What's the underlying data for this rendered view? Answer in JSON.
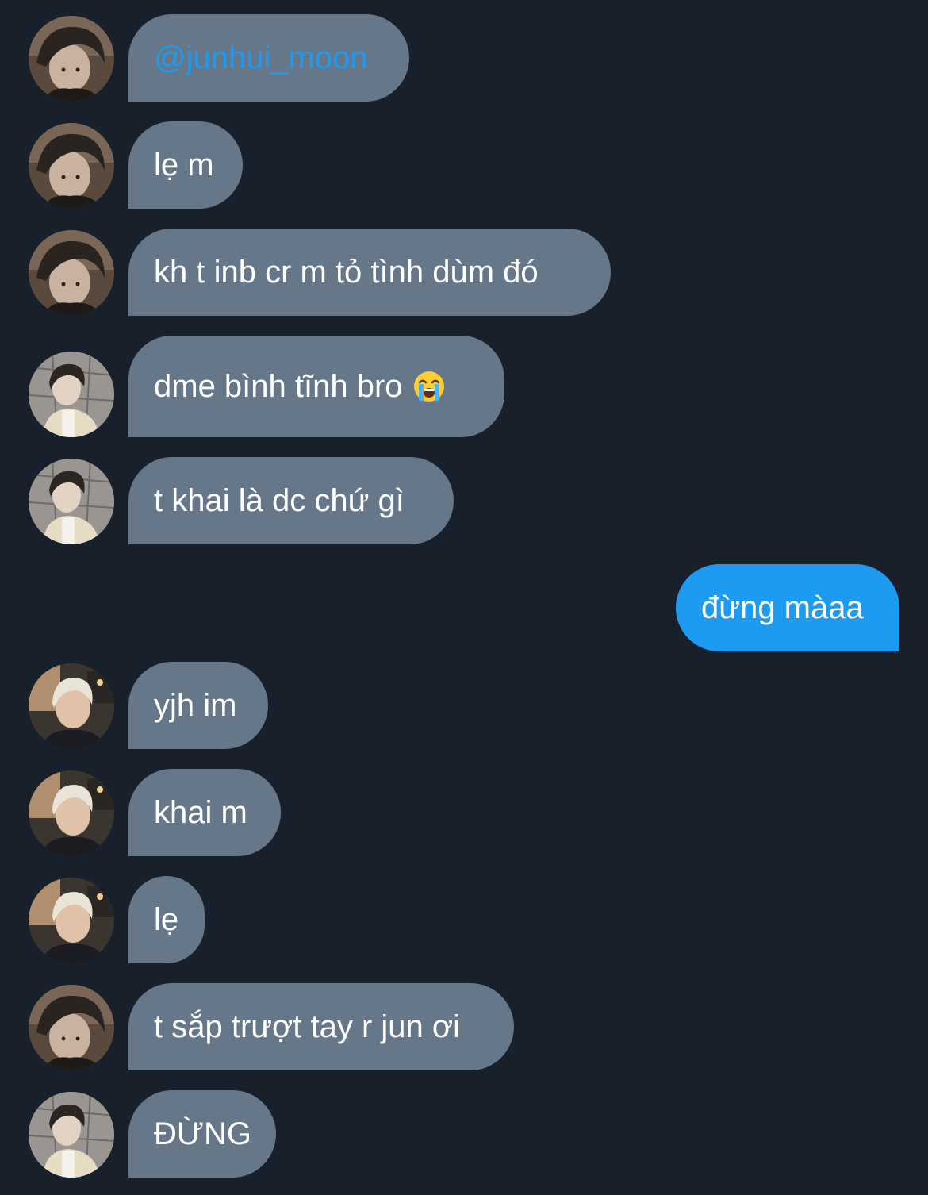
{
  "colors": {
    "background": "#17202b",
    "incoming_bubble": "#66778a",
    "outgoing_bubble": "#1d9bf0",
    "mention": "#1d9bf0",
    "text": "#ffffff"
  },
  "messages": [
    {
      "sender": "avatar-a",
      "direction": "incoming",
      "text": "@junhui_moon",
      "is_mention": true
    },
    {
      "sender": "avatar-a",
      "direction": "incoming",
      "text": "lẹ m"
    },
    {
      "sender": "avatar-a",
      "direction": "incoming",
      "text": "kh t inb cr m tỏ tình dùm đó"
    },
    {
      "sender": "avatar-b",
      "direction": "incoming",
      "text": "dme bình tĩnh bro",
      "emoji": "loudly-crying-face"
    },
    {
      "sender": "avatar-b",
      "direction": "incoming",
      "text": "t khai là dc chứ gì"
    },
    {
      "sender": "me",
      "direction": "outgoing",
      "text": "đừng màaa"
    },
    {
      "sender": "avatar-c",
      "direction": "incoming",
      "text": "yjh im"
    },
    {
      "sender": "avatar-c",
      "direction": "incoming",
      "text": "khai m"
    },
    {
      "sender": "avatar-c",
      "direction": "incoming",
      "text": "lẹ"
    },
    {
      "sender": "avatar-a",
      "direction": "incoming",
      "text": "t sắp trượt tay r jun ơi"
    },
    {
      "sender": "avatar-b",
      "direction": "incoming",
      "text": "ĐỪNG"
    }
  ]
}
